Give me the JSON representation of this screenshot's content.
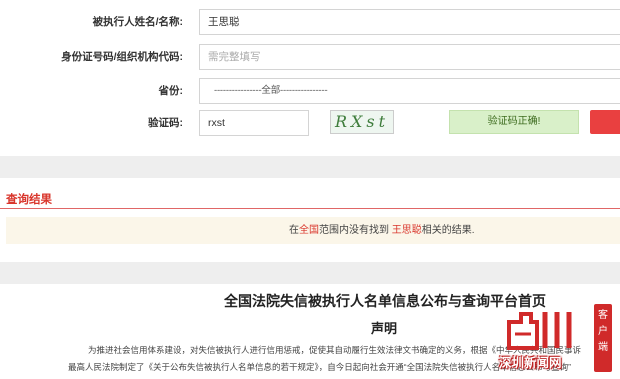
{
  "form": {
    "name": {
      "label": "被执行人姓名/名称:",
      "value": "王思聪"
    },
    "id": {
      "label": "身份证号码/组织机构代码:",
      "placeholder": "需完整填写"
    },
    "province": {
      "label": "省份:",
      "value": "----------------全部----------------"
    },
    "captcha": {
      "label": "验证码:",
      "value": "rxst",
      "image_text": "RXst",
      "status": "验证码正确!"
    }
  },
  "result": {
    "title": "查询结果",
    "message": {
      "prefix": "在",
      "scope": "全国",
      "middle": "范围内没有找到",
      "name": "王思聪",
      "suffix": "相关的结果."
    }
  },
  "declaration": {
    "title": "全国法院失信被执行人名单信息公布与查询平台首页",
    "subtitle": "声明",
    "para1": "为推进社会信用体系建设，对失信被执行人进行信用惩戒，促使其自动履行生效法律文书确定的义务，根据《中华人民共和国民事诉",
    "para2": "最高人民法院制定了《关于公布失信被执行人名单信息的若干规定》，自今日起向社会开通“全国法院失信被执行人名单信息公布与查询”"
  },
  "watermark": {
    "seal": "客户端",
    "name": "深圳新闻网"
  },
  "colors": {
    "accent_red": "#d9362c",
    "result_bg": "#fbf6e9",
    "captcha_ok_bg": "#d9f0c9"
  }
}
